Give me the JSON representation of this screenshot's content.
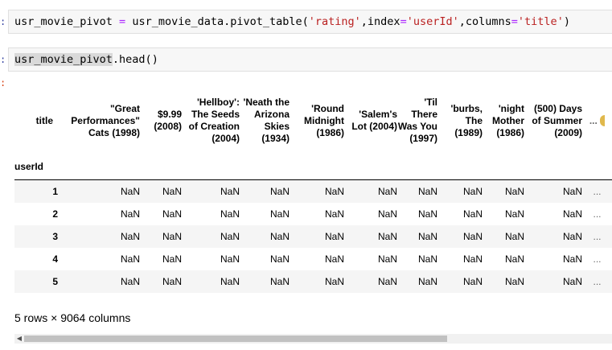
{
  "cell1": {
    "prompt": ":",
    "code_var": "usr_movie_pivot",
    "code_assign": " = ",
    "code_call": "usr_movie_data.pivot_table(",
    "arg1": "'rating'",
    "comma1": ",index",
    "eq1": "=",
    "arg2": "'userId'",
    "comma2": ",columns",
    "eq2": "=",
    "arg3": "'title'",
    "close": ")"
  },
  "cell2": {
    "prompt": ":",
    "code_var": "usr_movie_pivot",
    "code_call": ".head()"
  },
  "out_prompt": ":",
  "dataframe": {
    "columns_name": "title",
    "index_name": "userId",
    "columns": [
      "\"Great Performances\" Cats (1998)",
      "$9.99 (2008)",
      "'Hellboy': The Seeds of Creation (2004)",
      "'Neath the Arizona Skies (1934)",
      "'Round Midnight (1986)",
      "'Salem's Lot (2004)",
      "'Til There Was You (1997)",
      "'burbs, The (1989)",
      "'night Mother (1986)",
      "(500) Days of Summer (2009)"
    ],
    "ellipsis": "...",
    "rows": [
      {
        "index": "1",
        "values": [
          "NaN",
          "NaN",
          "NaN",
          "NaN",
          "NaN",
          "NaN",
          "NaN",
          "NaN",
          "NaN",
          "NaN"
        ]
      },
      {
        "index": "2",
        "values": [
          "NaN",
          "NaN",
          "NaN",
          "NaN",
          "NaN",
          "NaN",
          "NaN",
          "NaN",
          "NaN",
          "NaN"
        ]
      },
      {
        "index": "3",
        "values": [
          "NaN",
          "NaN",
          "NaN",
          "NaN",
          "NaN",
          "NaN",
          "NaN",
          "NaN",
          "NaN",
          "NaN"
        ]
      },
      {
        "index": "4",
        "values": [
          "NaN",
          "NaN",
          "NaN",
          "NaN",
          "NaN",
          "NaN",
          "NaN",
          "NaN",
          "NaN",
          "NaN"
        ]
      },
      {
        "index": "5",
        "values": [
          "NaN",
          "NaN",
          "NaN",
          "NaN",
          "NaN",
          "NaN",
          "NaN",
          "NaN",
          "NaN",
          "NaN"
        ]
      }
    ]
  },
  "footer": "5 rows × 9064 columns",
  "scrollbar": {
    "left_arrow_icon": "triangle-left-icon",
    "thumb_fraction": 0.72
  },
  "colors": {
    "string": "#ba2121",
    "operator": "#aa22ff",
    "prompt": "#303f9f",
    "stripe": "#f5f5f5"
  }
}
